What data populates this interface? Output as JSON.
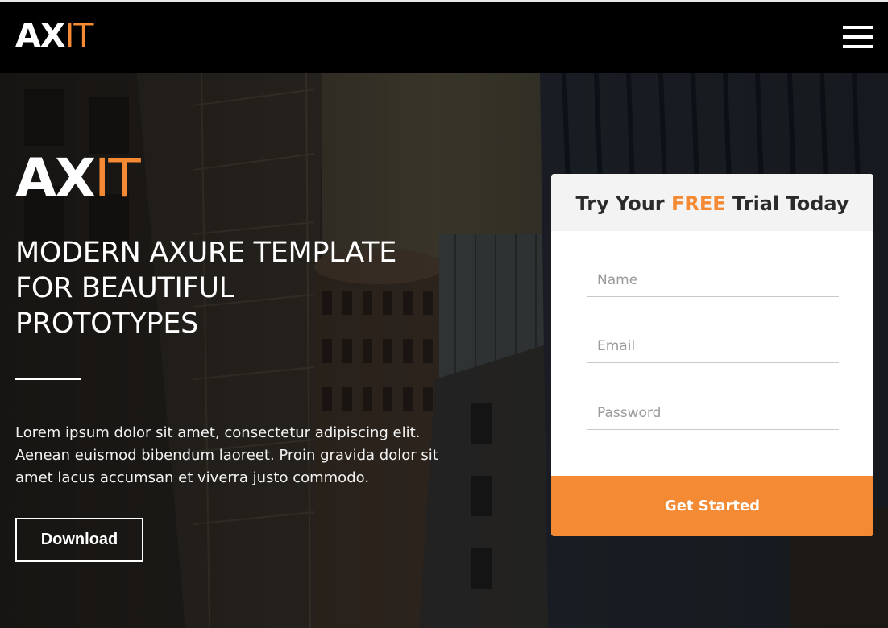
{
  "navbar": {
    "logo_ax": "AX",
    "logo_it": "IT"
  },
  "hero": {
    "logo_ax": "AX",
    "logo_it": "IT",
    "title_line1": "MODERN AXURE TEMPLATE",
    "title_line2": "FOR BEAUTIFUL",
    "title_line3": "PROTOTYPES",
    "desc_line1": "Lorem ipsum dolor sit amet, consectetur adipiscing elit.",
    "desc_line2": "Aenean euismod bibendum laoreet. Proin gravida dolor sit",
    "desc_line3": "amet lacus accumsan et viverra justo commodo.",
    "download_label": "Download"
  },
  "trial_form": {
    "heading_pre": "Try Your",
    "heading_highlight": "FREE",
    "heading_post": "Trial Today",
    "name_placeholder": "Name",
    "email_placeholder": "Email",
    "password_placeholder": "Password",
    "submit_label": "Get Started"
  },
  "colors": {
    "accent": "#f58a34",
    "navbar_bg": "#000000",
    "card_header_bg": "#f3f3f3"
  },
  "icons": {
    "menu": "hamburger-menu-icon"
  }
}
